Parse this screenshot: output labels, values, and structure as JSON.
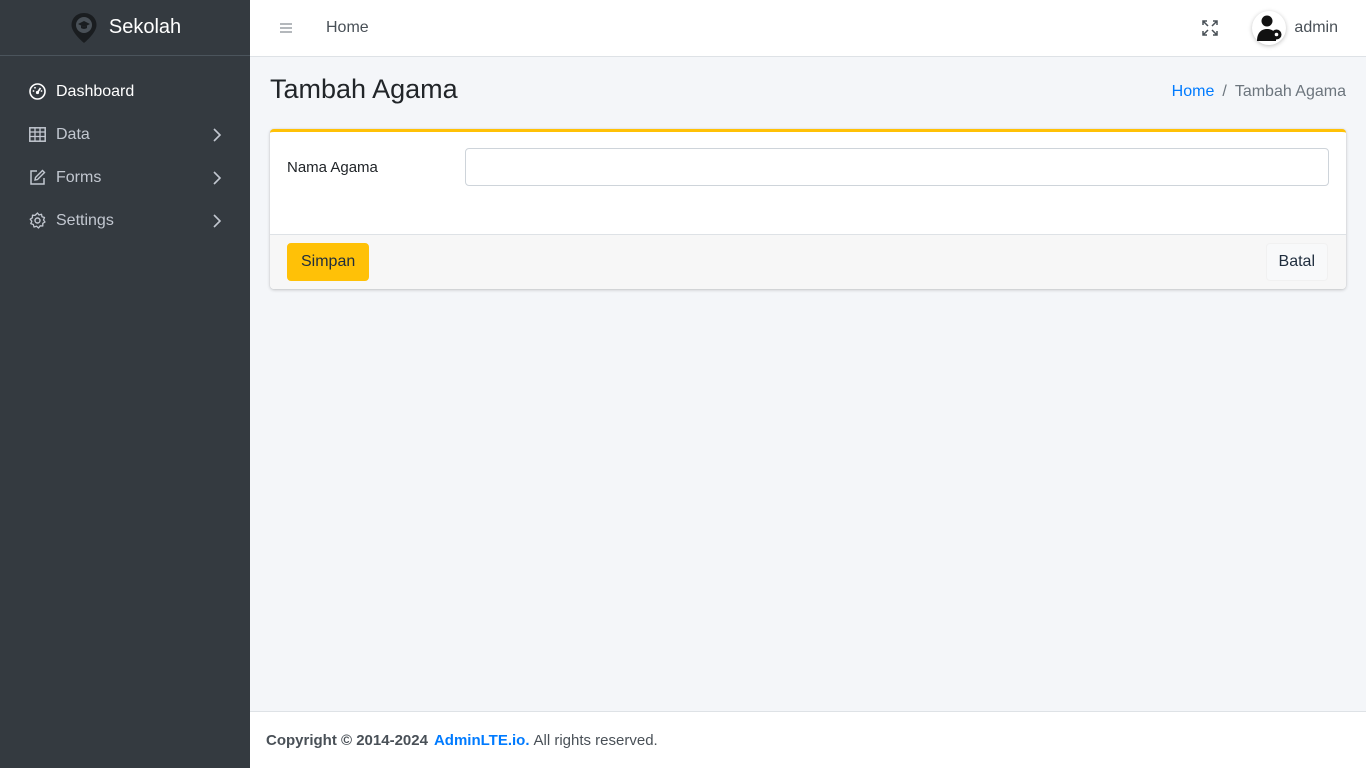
{
  "brand": {
    "name": "Sekolah",
    "icon": "graduation-pin-icon"
  },
  "sidebar": {
    "items": [
      {
        "label": "Dashboard",
        "icon": "tachometer-icon",
        "has_children": false,
        "active": true
      },
      {
        "label": "Data",
        "icon": "table-icon",
        "has_children": true,
        "active": false
      },
      {
        "label": "Forms",
        "icon": "edit-icon",
        "has_children": true,
        "active": false
      },
      {
        "label": "Settings",
        "icon": "gear-icon",
        "has_children": true,
        "active": false
      }
    ]
  },
  "header": {
    "home_label": "Home",
    "user_name": "admin"
  },
  "page": {
    "title": "Tambah Agama",
    "breadcrumb": {
      "home": "Home",
      "separator": "/",
      "current": "Tambah Agama"
    }
  },
  "form": {
    "field_label": "Nama Agama",
    "field_value": "",
    "field_placeholder": "",
    "save_label": "Simpan",
    "cancel_label": "Batal"
  },
  "footer": {
    "copyright": "Copyright © 2014-2024",
    "link_text": "AdminLTE.io.",
    "rights": "All rights reserved."
  },
  "colors": {
    "sidebar_bg": "#343a40",
    "accent_warning": "#ffc107",
    "link": "#007bff"
  }
}
